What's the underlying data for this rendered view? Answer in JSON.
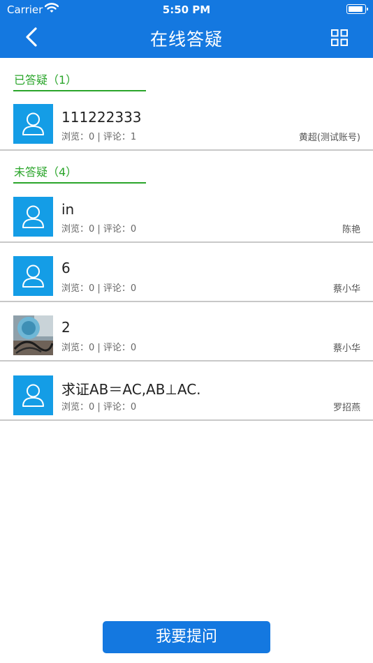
{
  "status_bar": {
    "carrier": "Carrier",
    "time": "5:50 PM"
  },
  "nav": {
    "title": "在线答疑",
    "back_icon": "chevron-left-icon",
    "menu_icon": "grid-icon"
  },
  "answered": {
    "header": "已答疑（1）",
    "items": [
      {
        "title": "111222333",
        "stats": "浏览：0 | 评论：1",
        "author": "黄超(测试账号)",
        "avatar": "default-user-icon"
      }
    ]
  },
  "unanswered": {
    "header": "未答疑（4）",
    "items": [
      {
        "title": "in",
        "stats": "浏览：0 | 评论：0",
        "author": "陈艳",
        "avatar": "default-user-icon"
      },
      {
        "title": "6",
        "stats": "浏览：0 | 评论：0",
        "author": "蔡小华",
        "avatar": "default-user-icon"
      },
      {
        "title": "2",
        "stats": "浏览：0 | 评论：0",
        "author": "蔡小华",
        "avatar": "photo-thumbnail"
      },
      {
        "title": "求证AB＝AC,AB⊥AC.",
        "stats": "浏览：0 | 评论：0",
        "author": "罗招燕",
        "avatar": "default-user-icon"
      }
    ]
  },
  "ask_button": "我要提问",
  "colors": {
    "primary": "#1478e0",
    "avatar_bg": "#149de6",
    "section_green": "#2aa52a",
    "divider": "#c8c8c8"
  }
}
